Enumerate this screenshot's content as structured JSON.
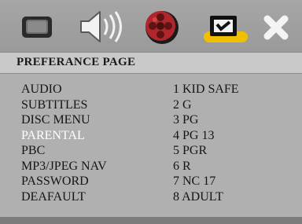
{
  "toolbar": {
    "icons": [
      {
        "name": "general-setup-icon"
      },
      {
        "name": "audio-speaker-icon"
      },
      {
        "name": "video-reel-icon"
      },
      {
        "name": "preference-check-icon"
      },
      {
        "name": "exit-close-icon"
      }
    ],
    "selected_icon": "preference-check-icon",
    "accent_color": "#f0c000"
  },
  "header": {
    "title": "PREFERANCE PAGE"
  },
  "menu": {
    "items": [
      {
        "label": "AUDIO"
      },
      {
        "label": "SUBTITLES"
      },
      {
        "label": "DISC MENU"
      },
      {
        "label": "PARENTAL"
      },
      {
        "label": "PBC"
      },
      {
        "label": "MP3/JPEG NAV"
      },
      {
        "label": "PASSWORD"
      },
      {
        "label": "DEAFAULT"
      }
    ],
    "selected_item": "PARENTAL",
    "options": [
      {
        "label": "1 KID SAFE"
      },
      {
        "label": "2 G"
      },
      {
        "label": "3 PG"
      },
      {
        "label": "4 PG 13"
      },
      {
        "label": "5 PGR"
      },
      {
        "label": "6 R"
      },
      {
        "label": "7 NC 17"
      },
      {
        "label": "8 ADULT"
      }
    ]
  }
}
